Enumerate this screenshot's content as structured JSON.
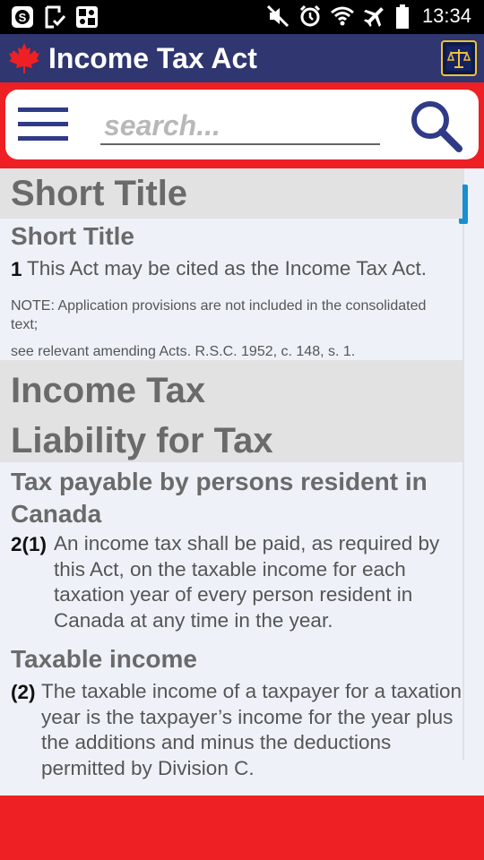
{
  "status_bar": {
    "time": "13:34",
    "left_icons": [
      "skype-icon",
      "download-check-icon",
      "dice-icon"
    ],
    "right_icons": [
      "mute-icon",
      "alarm-icon",
      "wifi-icon",
      "airplane-mode-icon",
      "battery-icon"
    ]
  },
  "app_bar": {
    "title": "Income Tax Act",
    "logo_icon": "maple-leaf-icon",
    "action_icon": "scales-icon",
    "bg_color": "#2f3670"
  },
  "search": {
    "placeholder": "search...",
    "value": "",
    "menu_icon": "hamburger-menu-icon",
    "search_icon": "magnifier-icon",
    "band_color": "#ee2024"
  },
  "content": {
    "section1_title": "Short Title",
    "subhead1": "Short Title",
    "para1_num": "1",
    "para1_text": "This Act may be cited as the Income Tax Act.",
    "note1": "NOTE: Application provisions are not included in the consolidated text;",
    "note2": "see relevant amending Acts. R.S.C. 1952, c. 148, s. 1.",
    "section2_title_line1": "Income Tax",
    "section2_title_line2": "Liability for Tax",
    "subhead2": "Tax payable by persons resident in Canada",
    "para2_num": "2(1)",
    "para2_text": "An income tax shall be paid, as required by this Act, on the taxable income for each taxation year of every person resident in Canada at any time in the year.",
    "subhead3": "Taxable income",
    "para3_num": "(2)",
    "para3_text": "The taxable income of a taxpayer for a taxation year is the taxpayer’s income for the year plus the additions and minus the deductions permitted by Division C."
  },
  "footer": {
    "bg_color": "#ee2024"
  }
}
